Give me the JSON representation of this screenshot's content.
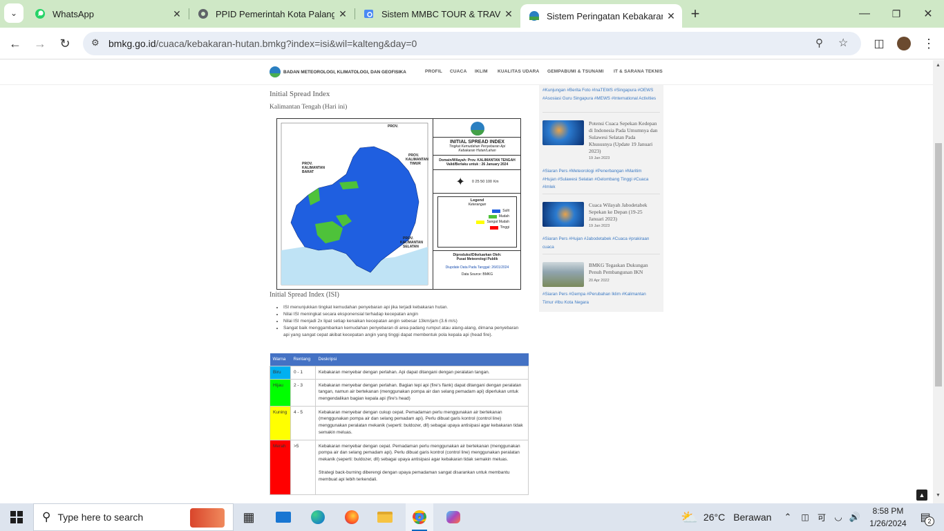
{
  "browser": {
    "tabs": [
      {
        "title": "WhatsApp",
        "icon": "whatsapp-icon"
      },
      {
        "title": "PPID Pemerintah Kota Palangka",
        "icon": "globe-icon"
      },
      {
        "title": "Sistem MMBC TOUR & TRAVEL",
        "icon": "search-icon"
      },
      {
        "title": "Sistem Peringatan Kebakaran H",
        "icon": "bmkg-icon"
      }
    ],
    "new_tab": "+",
    "url_host": "bmkg.go.id",
    "url_path": "/cuaca/kebakaran-hutan.bmkg?index=isi&wil=kalteng&day=0"
  },
  "site": {
    "agency": "BADAN METEOROLOGI, KLIMATOLOGI, DAN GEOFISIKA",
    "logo_text": "BMKG",
    "nav": [
      "PROFIL",
      "CUACA",
      "IKLIM",
      "KUALITAS UDARA",
      "GEMPABUMI & TSUNAMI",
      "IT & SARANA TEKNIS"
    ]
  },
  "main": {
    "title": "Initial Spread Index",
    "subtitle": "Kalimantan Tengah (Hari ini)",
    "section_title": "Initial Spread Index (ISI)",
    "map": {
      "label_kaltim": "PROV.\nKALIMANTAN\nTIMUR",
      "label_kalbar": "PROV.\nKALIMANTAN\nBARAT",
      "label_kaltim2": "PROV.\nKALIMANTAN\nTIMUR",
      "label_kalsel": "PROV.\nKALIMANTAN\nSELATAN",
      "panel_title": "INITIAL SPREAD INDEX",
      "panel_sub": "Tingkat Kemudahan Penyebaran Api",
      "panel_sub2": "Kebakaran Hutan/Lahan",
      "domain_line": "Domain/Wilayah: Prov. KALIMANTAN TENGAH",
      "valid_line": "Valid/Berlaku untuk : 26 January 2024",
      "scale_text": "0   25 50      100",
      "scale_unit": "Km",
      "legend_title": "Legend",
      "legend_sub": "Keterangan",
      "legend_items": [
        "Sulit",
        "Mudah",
        "Sangat Mudah",
        "Tinggi"
      ],
      "credit1": "Diproduksi/Dikeluarkan Oleh:",
      "credit2": "Pusat Meteorologi Publik",
      "credit3": "Diupdate Data Pada Tanggal: 26/01/2024",
      "credit4": "Data Source: BMKG"
    },
    "notes": [
      "ISI menunjukkan tingkat kemudahan penyebaran api jika terjadi kebakaran hutan.",
      "Nilai ISI meningkat secara eksponensial terhadap kecepatan angin",
      "Nilai ISI menjadi 2x lipat setiap kenaikan kecepatan angin sebesar 13km/jam (3.6 m/s)",
      "Sangat baik menggambarkan kemudahan penyebaran di area padang rumput atau alang-alang, dimana penyebaran api yang sangat cepat akibat kecepatan angin yang tinggi dapat membentuk pola kepala api (head fire)."
    ],
    "table": {
      "headers": [
        "Warna",
        "Rentang",
        "Deskripsi"
      ],
      "rows": [
        {
          "color_name": "Biru",
          "color": "#00b0f0",
          "range": "0 - 1",
          "desc": "Kebakaran menyebar dengan perlahan. Api dapat ditangani dengan peralatan tangan."
        },
        {
          "color_name": "Hijau",
          "color": "#00ff00",
          "range": "2 - 3",
          "desc": "Kebakaran menyebar dengan perlahan. Bagian tepi api (fire's flank) dapat ditangani dengan peralatan tangan, namun air bertekanan (menggunakan pompa air dan selang pemadam api) diperlukan untuk mengendalikan bagian kepala api (fire's head)"
        },
        {
          "color_name": "Kuning",
          "color": "#ffff00",
          "range": "4 - 5",
          "desc": "Kebakaran menyebar dengan cukup cepat. Pemadaman perlu menggunakan air bertekanan (menggunakan pompa air dan selang pemadam api). Perlu dibuat garis kontrol (control line) menggunakan peralatan mekanik (seperti: buldozer, dll) sebagai upaya antisipasi agar kebakaran tidak semakin meluas."
        },
        {
          "color_name": "Merah",
          "color": "#ff0000",
          "range": ">5",
          "desc": "Kebakaran menyebar dengan cepat. Pemadaman perlu menggunakan air bertekanan (menggunakan pompa air dan selang pemadam api). Perlu dibuat garis kontrol (control line) menggunakan peralatan mekanik (seperti: buldozer, dll) sebagai upaya antisipasi agar kebakaran tidak semakin meluas.",
          "desc2": "Strategi back-burning diberengi dengan upaya pemadaman sangat disarankan untuk membantu membuat api lebih terkendali."
        }
      ]
    }
  },
  "sidebar": {
    "tags0": "#Kunjungan #Berita Foto #InaTEWS #Singapura #OEWS #Asosiasi Guru Singapura #MEWS #International Activities",
    "items": [
      {
        "title": "Potensi Cuaca Sepekan Kedepan di Indonesia Pada Umumnya dan Sulawesi Selatan Pada Khususnya (Update 19 Januari 2023)",
        "date": "19 Jan 2023",
        "tags": "#Siaran Pers #Meteorologi #Penerbangan #Maritim #Hujan #Sulawesi Selatan #Gelombang Tinggi #Cuaca #Imlek"
      },
      {
        "title": "Cuaca Wilayah Jabodetabek Sepekan ke Depan (19-25 Januari 2023)",
        "date": "19 Jan 2023",
        "tags": "#Siaran Pers #Hujan #Jabodetabek #Cuaca #prakiraan cuaca"
      },
      {
        "title": "BMKG Tegaskan Dukungan Penuh Pembangunan IKN",
        "date": "20 Apr 2022",
        "tags": "#Siaran Pers #Gempa #Perubahan Iklim #Kalimantan Timur #Ibu Kota Negara"
      }
    ]
  },
  "taskbar": {
    "search_placeholder": "Type here to search",
    "weather_temp": "26°C",
    "weather_text": "Berawan",
    "time": "8:58 PM",
    "date": "1/26/2024",
    "notif_count": "2"
  }
}
